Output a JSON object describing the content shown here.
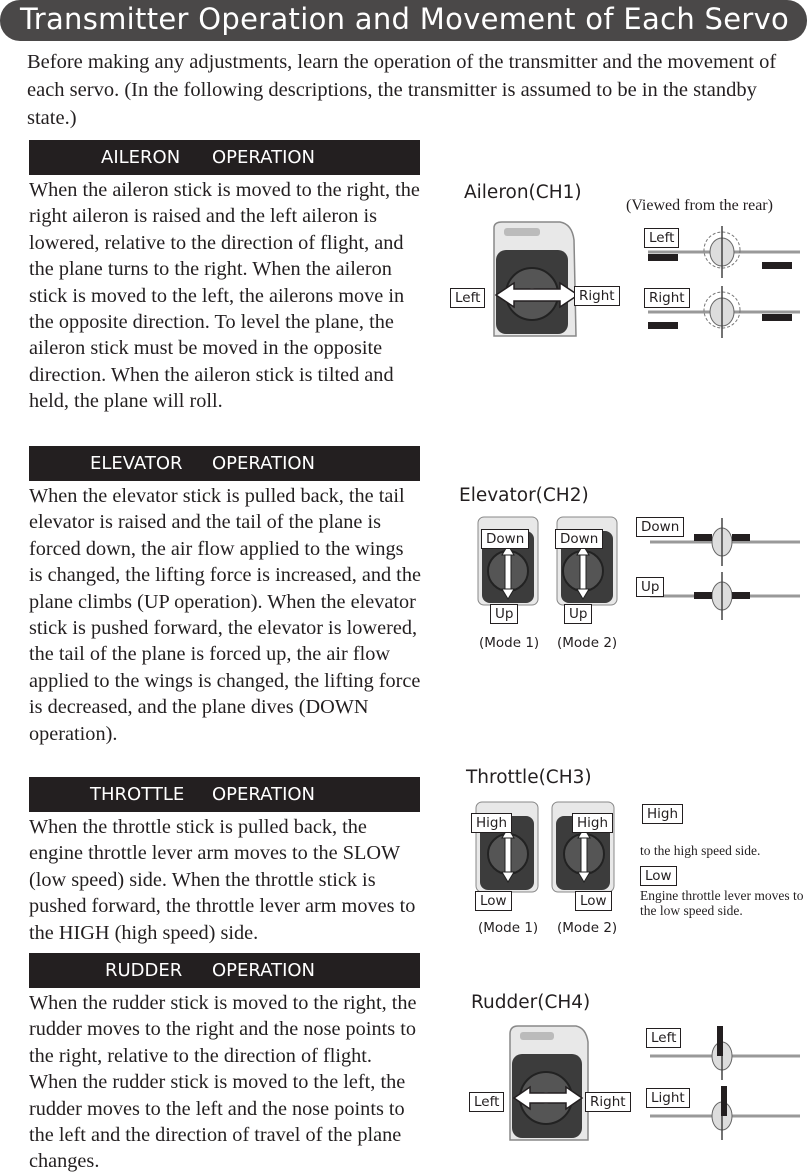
{
  "header": {
    "title": "Transmitter Operation and Movement of Each Servo"
  },
  "intro": "Before making any adjustments, learn the operation of the  transmitter and the movement of each servo. (In the following descriptions, the transmitter is assumed to be in the standby state.)",
  "sections": [
    {
      "id": "aileron",
      "heading_left": "AILERON",
      "heading_right": "OPERATION",
      "text": "When the aileron stick is moved to the right, the right aileron is raised and the left aileron is lowered, relative to the direction of flight, and the plane turns to the right. When the aileron stick is moved to the left, the ailerons move in the opposite direction. To level the plane, the aileron stick must be moved in the opposite direction. When the aileron stick is tilted and held, the plane will roll.",
      "diagram": {
        "title": "Aileron(CH1)",
        "note": "(Viewed from the rear)",
        "stick_labels": [
          "Left",
          "Right"
        ],
        "plane_labels": [
          "Left",
          "Right"
        ]
      }
    },
    {
      "id": "elevator",
      "heading_left": "ELEVATOR",
      "heading_right": "OPERATION",
      "text": "When the elevator stick is pulled back, the tail elevator is raised and the tail of the plane is forced down, the air flow applied to the wings is changed, the lifting force is increased, and the plane climbs (UP operation). When the elevator stick is pushed forward, the elevator is lowered, the tail of the plane is forced up, the air flow applied to the wings is changed, the lifting force is decreased, and the plane dives (DOWN operation).",
      "diagram": {
        "title": "Elevator(CH2)",
        "stick_labels_top": [
          "Down",
          "Down"
        ],
        "stick_labels_bottom": [
          "Up",
          "Up"
        ],
        "modes": [
          "(Mode 1)",
          "(Mode 2)"
        ],
        "plane_labels": [
          "Down",
          "Up"
        ]
      }
    },
    {
      "id": "throttle",
      "heading_left": "THROTTLE",
      "heading_right": "OPERATION",
      "text": "When the throttle stick is pulled back, the engine throttle lever arm moves to the SLOW (low speed) side. When the throttle stick is pushed forward, the throttle lever arm moves to the HIGH (high speed) side.",
      "diagram": {
        "title": "Throttle(CH3)",
        "stick_labels_top": [
          "High",
          "High"
        ],
        "stick_labels_bottom": [
          "Low",
          "Low"
        ],
        "modes": [
          "(Mode 1)",
          "(Mode 2)"
        ],
        "side_labels": [
          "High",
          "Low"
        ],
        "note_high": "to the high speed side.",
        "note_low": "Engine throttle lever moves to the low speed side."
      }
    },
    {
      "id": "rudder",
      "heading_left": "RUDDER",
      "heading_right": "OPERATION",
      "text": "When the rudder stick is moved to the right, the rudder moves to the right and the nose points to the right, relative to the direction of flight. When the rudder stick is moved to the left, the rudder moves to the left and the nose points to the left and the direction of travel of the plane changes.",
      "diagram": {
        "title": "Rudder(CH4)",
        "stick_labels": [
          "Left",
          "Right"
        ],
        "plane_labels": [
          "Left",
          "Light"
        ]
      }
    }
  ]
}
